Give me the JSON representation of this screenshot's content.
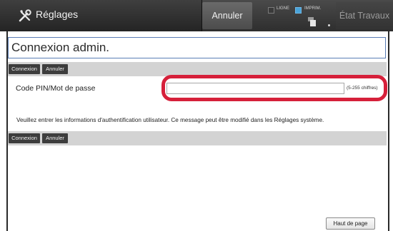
{
  "header": {
    "title": "Réglages",
    "annuler_label": "Annuler",
    "status_ligne": "LIGNE",
    "status_imprim": "IMPRIM.",
    "etat_label": "État Travaux"
  },
  "page": {
    "title": "Connexion admin.",
    "toolbar_top": {
      "connexion": "Connexion",
      "annuler": "Annuler"
    },
    "toolbar_bottom": {
      "connexion": "Connexion",
      "annuler": "Annuler"
    },
    "pin_label": "Code PIN/Mot de passe",
    "pin_value": "",
    "pin_hint": "(5-255 chiffres)",
    "info": "Veuillez entrer les informations d'authentification utilisateur. Ce message peut être modifié dans les Réglages système.",
    "haut_de_page": "Haut de page"
  },
  "colors": {
    "highlight": "#d6203a",
    "imprim_led": "#49a3d9"
  },
  "icons": {
    "title": "tools-icon",
    "job_status": "job-status-icon"
  }
}
